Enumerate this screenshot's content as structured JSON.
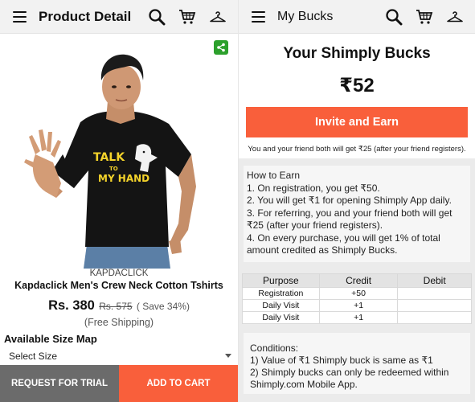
{
  "left": {
    "title": "Product Detail",
    "brand": "KAPDACLICK",
    "product_name": "Kapdaclick Men's Crew Neck Cotton Tshirts",
    "price": "Rs. 380",
    "mrp": "Rs. 575",
    "save": "( Save 34%)",
    "shipping": "(Free Shipping)",
    "size_title": "Available Size Map",
    "size_select": "Select Size",
    "tshirt_print": [
      "TALK",
      "TO",
      "MY HAND"
    ],
    "buttons": {
      "trial": "REQUEST FOR TRIAL",
      "cart": "ADD TO CART"
    },
    "icons": [
      "menu-icon",
      "search-icon",
      "cart-icon",
      "hanger-icon",
      "share-icon"
    ]
  },
  "right": {
    "title": "My Bucks",
    "heading": "Your Shimply Bucks",
    "amount": "₹52",
    "invite_label": "Invite and Earn",
    "invite_note": "You and your friend both will get ₹25 (after your friend registers).",
    "earn": {
      "title": "How to Earn",
      "lines": [
        "1. On registration, you get ₹50.",
        "2. You will get ₹1 for opening Shimply App daily.",
        "3. For referring, you and your friend both will get",
        "₹25 (after your friend registers).",
        "4. On every purchase, you will get 1% of total",
        "amount credited as Shimply Bucks."
      ]
    },
    "table": {
      "headers": [
        "Purpose",
        "Credit",
        "Debit"
      ],
      "rows": [
        [
          "Registration",
          "+50",
          ""
        ],
        [
          "Daily Visit",
          "+1",
          ""
        ],
        [
          "Daily Visit",
          "+1",
          ""
        ]
      ]
    },
    "conditions": {
      "title": "Conditions:",
      "lines": [
        "1) Value of ₹1 Shimply buck is same as ₹1",
        "2) Shimply bucks can only be redeemed within",
        "Shimply.com Mobile App."
      ]
    }
  },
  "colors": {
    "accent": "#f95f3b",
    "trial_button": "#6b6b6b",
    "share": "#2ca02c",
    "toolbar": "#f2f2f2"
  }
}
